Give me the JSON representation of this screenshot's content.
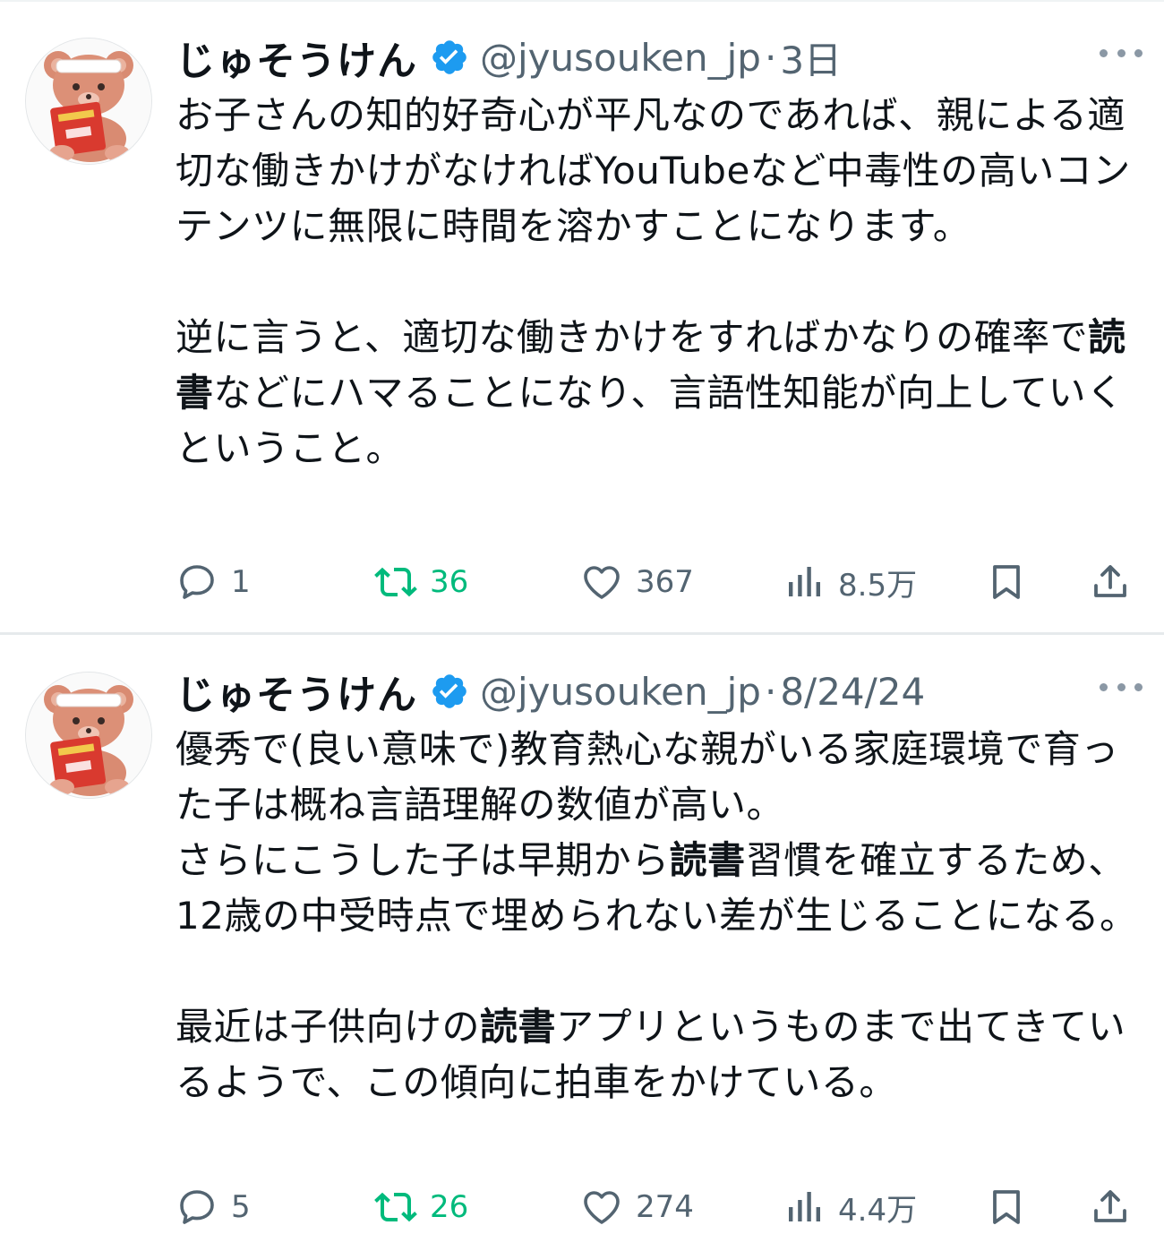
{
  "tweets": [
    {
      "user_name": "じゅそうけん",
      "handle": "@jyusouken_jp",
      "separator": "·",
      "date": "3日",
      "text_parts": [
        {
          "t": "お子さんの知的好奇心が平凡なのであれば、親による適切な働きかけがなければYouTubeなど中毒性の高いコンテンツに無限に時間を溶かすことになります。\n\n逆に言うと、適切な働きかけをすればかなりの確率で",
          "bold": false
        },
        {
          "t": "読書",
          "bold": true
        },
        {
          "t": "などにハマることになり、言語性知能が向上していくということ。",
          "bold": false
        }
      ],
      "replies": "1",
      "retweets": "36",
      "likes": "367",
      "views": "8.5万"
    },
    {
      "user_name": "じゅそうけん",
      "handle": "@jyusouken_jp",
      "separator": "·",
      "date": "8/24/24",
      "text_parts": [
        {
          "t": "優秀で(良い意味で)教育熱心な親がいる家庭環境で育った子は概ね言語理解の数値が高い。\nさらにこうした子は早期から",
          "bold": false
        },
        {
          "t": "読書",
          "bold": true
        },
        {
          "t": "習慣を確立するため、12歳の中受時点で埋められない差が生じることになる。\n\n最近は子供向けの",
          "bold": false
        },
        {
          "t": "読書",
          "bold": true
        },
        {
          "t": "アプリというものまで出てきているようで、この傾向に拍車をかけている。",
          "bold": false
        }
      ],
      "replies": "5",
      "retweets": "26",
      "likes": "274",
      "views": "4.4万"
    }
  ],
  "colors": {
    "text": "#0f1419",
    "muted": "#536471",
    "retweet": "#00ba7c",
    "verified": "#1d9bf0"
  },
  "icons": [
    "verified-badge-icon",
    "more-icon",
    "reply-icon",
    "retweet-icon",
    "like-icon",
    "views-icon",
    "bookmark-icon",
    "share-icon"
  ]
}
